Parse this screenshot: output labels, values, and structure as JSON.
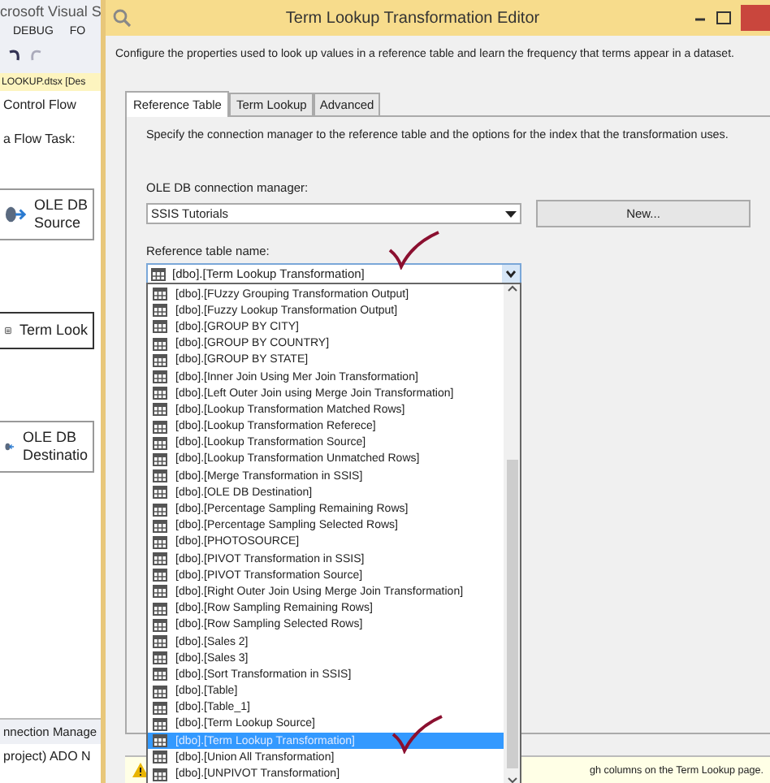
{
  "ide": {
    "title": "crosoft Visual S",
    "menu": [
      "DEBUG",
      "FO"
    ],
    "document_tab": "LOOKUP.dtsx [Des",
    "designer_tab": "Control Flow",
    "task_label": "a Flow Task:",
    "nodes": [
      {
        "kind": "source",
        "lines": [
          "OLE DB",
          "Source"
        ]
      },
      {
        "kind": "transform",
        "lines": [
          "Term Look"
        ]
      },
      {
        "kind": "destination",
        "lines": [
          "OLE DB",
          "Destinatio"
        ]
      }
    ],
    "connection_managers": "nnection Manage",
    "connection_item": "project) ADO N"
  },
  "dialog": {
    "title": "Term Lookup Transformation Editor",
    "description": "Configure the properties used to look up values in a reference table and learn the frequency that terms appear in a dataset.",
    "tabs": [
      {
        "label": "Reference Table",
        "selected": true
      },
      {
        "label": "Term Lookup",
        "selected": false
      },
      {
        "label": "Advanced",
        "selected": false
      }
    ],
    "instructions": "Specify the connection manager to the reference table and the options for the index that the transformation uses.",
    "connection_label": "OLE DB connection manager:",
    "connection_value": "SSIS Tutorials",
    "new_button": "New...",
    "table_label": "Reference table name:",
    "table_value": "[dbo].[Term Lookup Transformation]",
    "table_options": [
      {
        "label": "[dbo].[FUzzy Grouping Transformation Output]",
        "selected": false
      },
      {
        "label": "[dbo].[Fuzzy Lookup Transformation Output]",
        "selected": false
      },
      {
        "label": "[dbo].[GROUP BY CITY]",
        "selected": false
      },
      {
        "label": "[dbo].[GROUP BY COUNTRY]",
        "selected": false
      },
      {
        "label": "[dbo].[GROUP BY STATE]",
        "selected": false
      },
      {
        "label": "[dbo].[Inner Join Using Mer Join Transformation]",
        "selected": false
      },
      {
        "label": "[dbo].[Left Outer Join using Merge Join Transformation]",
        "selected": false
      },
      {
        "label": "[dbo].[Lookup Transformation Matched Rows]",
        "selected": false
      },
      {
        "label": "[dbo].[Lookup Transformation Referece]",
        "selected": false
      },
      {
        "label": "[dbo].[Lookup Transformation Source]",
        "selected": false
      },
      {
        "label": "[dbo].[Lookup Transformation Unmatched Rows]",
        "selected": false
      },
      {
        "label": "[dbo].[Merge Transformation in SSIS]",
        "selected": false
      },
      {
        "label": "[dbo].[OLE DB Destination]",
        "selected": false
      },
      {
        "label": "[dbo].[Percentage Sampling Remaining Rows]",
        "selected": false
      },
      {
        "label": "[dbo].[Percentage Sampling Selected Rows]",
        "selected": false
      },
      {
        "label": "[dbo].[PHOTOSOURCE]",
        "selected": false
      },
      {
        "label": "[dbo].[PIVOT Transformation in SSIS]",
        "selected": false
      },
      {
        "label": "[dbo].[PIVOT Transformation Source]",
        "selected": false
      },
      {
        "label": "[dbo].[Right Outer Join Using Merge Join Transformation]",
        "selected": false
      },
      {
        "label": "[dbo].[Row Sampling Remaining Rows]",
        "selected": false
      },
      {
        "label": "[dbo].[Row Sampling Selected Rows]",
        "selected": false
      },
      {
        "label": "[dbo].[Sales 2]",
        "selected": false
      },
      {
        "label": "[dbo].[Sales 3]",
        "selected": false
      },
      {
        "label": "[dbo].[Sort Transformation in SSIS]",
        "selected": false
      },
      {
        "label": "[dbo].[Table]",
        "selected": false
      },
      {
        "label": "[dbo].[Table_1]",
        "selected": false
      },
      {
        "label": "[dbo].[Term Lookup Source]",
        "selected": false
      },
      {
        "label": "[dbo].[Term Lookup Transformation]",
        "selected": true
      },
      {
        "label": "[dbo].[Union All Transformation]",
        "selected": false
      },
      {
        "label": "[dbo].[UNPIVOT Transformation]",
        "selected": false
      }
    ],
    "warning": "gh columns on the Term Lookup page."
  }
}
